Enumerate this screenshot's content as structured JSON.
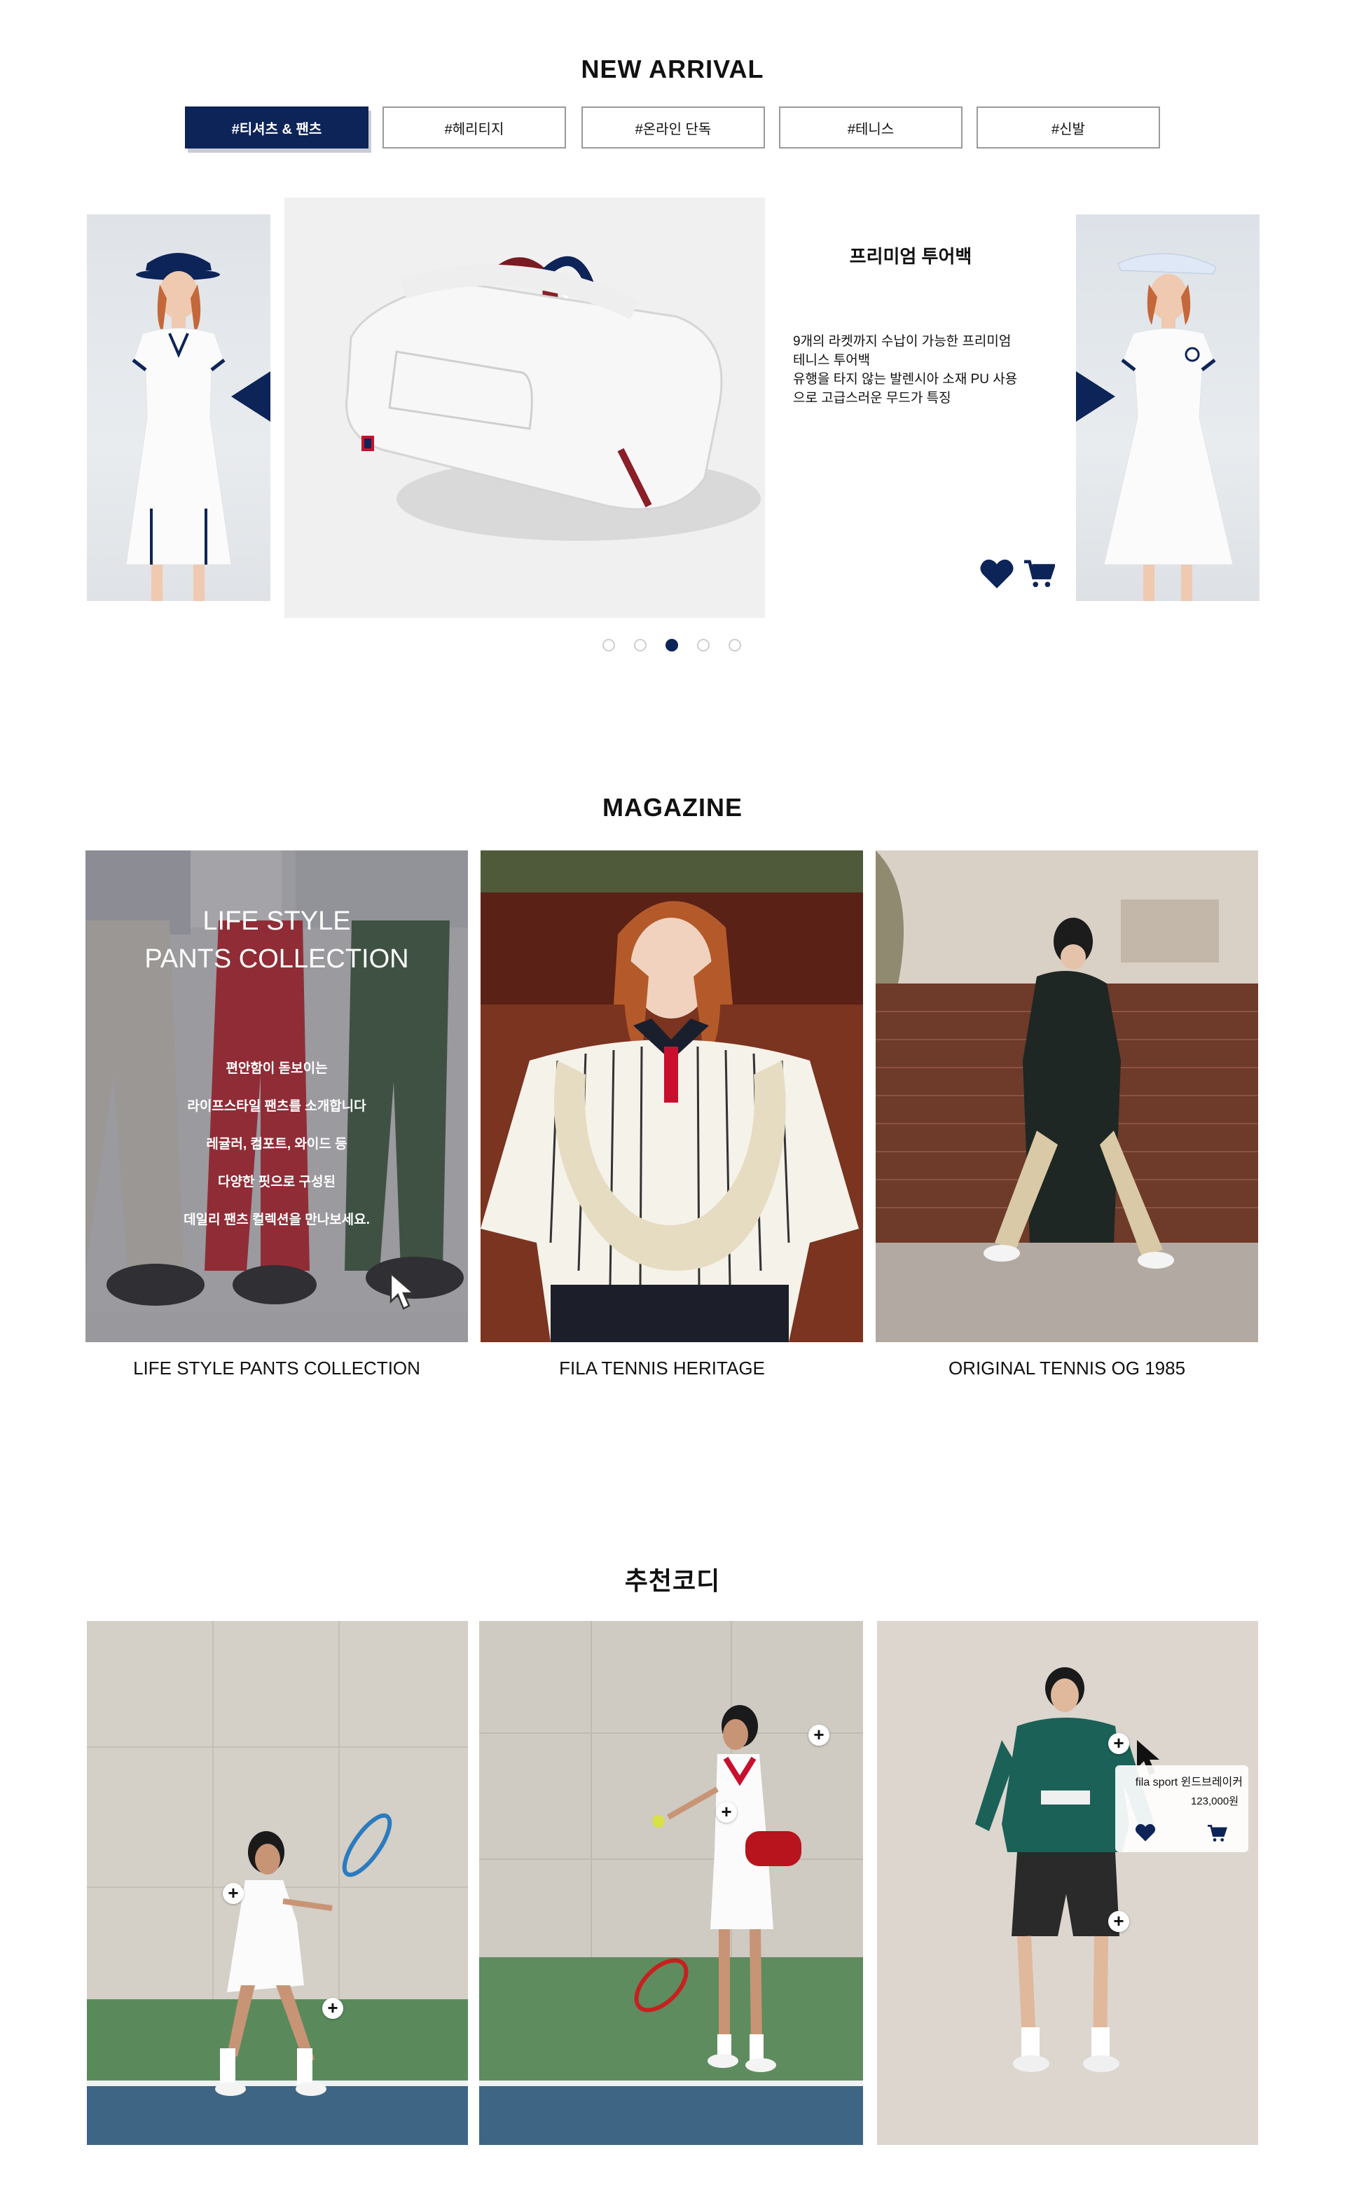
{
  "new_arrival": {
    "title": "NEW ARRIVAL",
    "tabs": [
      "#티셔츠 & 팬츠",
      "#헤리티지",
      "#온라인 단독",
      "#테니스",
      "#신발"
    ],
    "active_tab": 0,
    "product": {
      "name": "프리미엄 투어백",
      "description_lines": [
        "9개의 라켓까지 수납이 가능한 프리미엄",
        "테니스 투어백",
        "유행을 타지 않는 발렌시아 소재 PU 사용",
        "으로 고급스러운 무드가 특징"
      ]
    },
    "dots_count": 5,
    "active_dot": 2
  },
  "magazine": {
    "title": "MAGAZINE",
    "overlay": {
      "title_lines": [
        "LIFE STYLE",
        "PANTS COLLECTION"
      ],
      "body_lines": [
        "편안함이 돋보이는",
        "라이프스타일 팬츠를 소개합니다",
        "레귤러, 컴포트, 와이드 등",
        "다양한 핏으로 구성된",
        "데일리 팬츠 컬렉션을 만나보세요."
      ]
    },
    "cards": [
      {
        "caption": "LIFE STYLE PANTS COLLECTION"
      },
      {
        "caption": "FILA TENNIS HERITAGE"
      },
      {
        "caption": "ORIGINAL TENNIS OG 1985"
      }
    ]
  },
  "coordi": {
    "title": "추천코디",
    "popup": {
      "name": "fila sport 윈드브레이커",
      "price": "123,000원"
    },
    "hotspot_symbol": "+"
  },
  "colors": {
    "navy": "#0d2458",
    "border": "#9a9a9a"
  }
}
